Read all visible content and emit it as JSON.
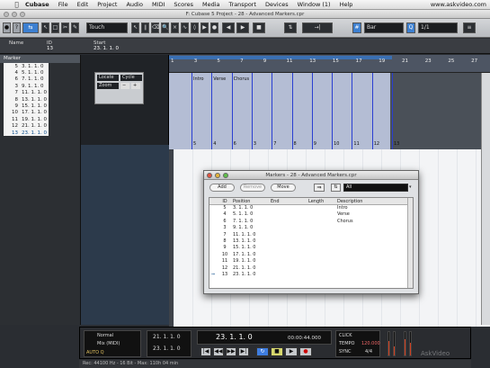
{
  "menubar": {
    "apple": "",
    "items": [
      "Cubase",
      "File",
      "Edit",
      "Project",
      "Audio",
      "MIDI",
      "Scores",
      "Media",
      "Transport",
      "Devices",
      "Window (1)",
      "Help"
    ],
    "right": "www.askvideo.com"
  },
  "window_title": "F: Cubase 5 Project - 28 - Advanced Markers.cpr",
  "toolbar": {
    "touch_mode": "Touch",
    "grid": "Bar",
    "quantize": "1/1"
  },
  "infoline": {
    "name_label": "Name",
    "name_value": "",
    "id_label": "ID",
    "id_value": "13",
    "start_label": "Start",
    "start_value": "23. 1. 1. 0"
  },
  "inspector": {
    "header": "Marker",
    "markers": [
      {
        "id": "5",
        "pos": "3. 1. 1. 0"
      },
      {
        "id": "4",
        "pos": "5. 1. 1. 0"
      },
      {
        "id": "6",
        "pos": "7. 1. 1. 0"
      },
      {
        "id": "3",
        "pos": "9. 1. 1. 0"
      },
      {
        "id": "7",
        "pos": "11. 1. 1. 0"
      },
      {
        "id": "8",
        "pos": "13. 1. 1. 0"
      },
      {
        "id": "9",
        "pos": "15. 1. 1. 0"
      },
      {
        "id": "10",
        "pos": "17. 1. 1. 0"
      },
      {
        "id": "11",
        "pos": "19. 1. 1. 0"
      },
      {
        "id": "12",
        "pos": "21. 1. 1. 0"
      },
      {
        "id": "13",
        "pos": "23. 1. 1. 0"
      }
    ]
  },
  "track_header": {
    "locate_label": "Locate",
    "locate_value": "Cycle",
    "zoom_label": "Zoom"
  },
  "ruler": {
    "bars": [
      "1",
      "3",
      "5",
      "7",
      "9",
      "11",
      "13",
      "15",
      "17",
      "19",
      "21",
      "23",
      "25",
      "27"
    ],
    "marker_names": [
      "Intro",
      "Verse",
      "Chorus"
    ],
    "marker_numbers": [
      "5",
      "4",
      "6",
      "3",
      "7",
      "8",
      "9",
      "10",
      "11",
      "12",
      "13"
    ]
  },
  "markers_window": {
    "title": "Markers - 28 - Advanced Markers.cpr",
    "add": "Add",
    "remove": "Remove",
    "move": "Move",
    "filter": "All",
    "columns": [
      "ID",
      "Position",
      "End",
      "Length",
      "Description"
    ],
    "rows": [
      {
        "ptr": "",
        "id": "5",
        "pos": "3. 1. 1. 0",
        "end": "",
        "len": "",
        "desc": "Intro"
      },
      {
        "ptr": "",
        "id": "4",
        "pos": "5. 1. 1. 0",
        "end": "",
        "len": "",
        "desc": "Verse"
      },
      {
        "ptr": "",
        "id": "6",
        "pos": "7. 1. 1. 0",
        "end": "",
        "len": "",
        "desc": "Chorus"
      },
      {
        "ptr": "",
        "id": "3",
        "pos": "9. 1. 1. 0",
        "end": "",
        "len": "",
        "desc": ""
      },
      {
        "ptr": "",
        "id": "7",
        "pos": "11. 1. 1. 0",
        "end": "",
        "len": "",
        "desc": ""
      },
      {
        "ptr": "",
        "id": "8",
        "pos": "13. 1. 1. 0",
        "end": "",
        "len": "",
        "desc": ""
      },
      {
        "ptr": "",
        "id": "9",
        "pos": "15. 1. 1. 0",
        "end": "",
        "len": "",
        "desc": ""
      },
      {
        "ptr": "",
        "id": "10",
        "pos": "17. 1. 1. 0",
        "end": "",
        "len": "",
        "desc": ""
      },
      {
        "ptr": "",
        "id": "11",
        "pos": "19. 1. 1. 0",
        "end": "",
        "len": "",
        "desc": ""
      },
      {
        "ptr": "",
        "id": "12",
        "pos": "21. 1. 1. 0",
        "end": "",
        "len": "",
        "desc": ""
      },
      {
        "ptr": "⇒",
        "id": "13",
        "pos": "23. 1. 1. 0",
        "end": "",
        "len": "",
        "desc": ""
      }
    ]
  },
  "transport": {
    "mode1": "Normal",
    "mode2": "Mix (MIDI)",
    "auto_q": "AUTO Q",
    "left_locator": "21. 1. 1. 0",
    "right_locator": "23. 1. 1. 0",
    "position": "23. 1. 1. 0",
    "time": "00:00:44.000",
    "click": "CLICK",
    "tempo": "TEMPO",
    "sync": "SYNC",
    "tempo_value": "120.000",
    "signature": "4/4"
  },
  "statusbar": "Rec: 44100 Hz - 16 Bit - Max: 110h 04 min",
  "watermark": "AskVideo"
}
